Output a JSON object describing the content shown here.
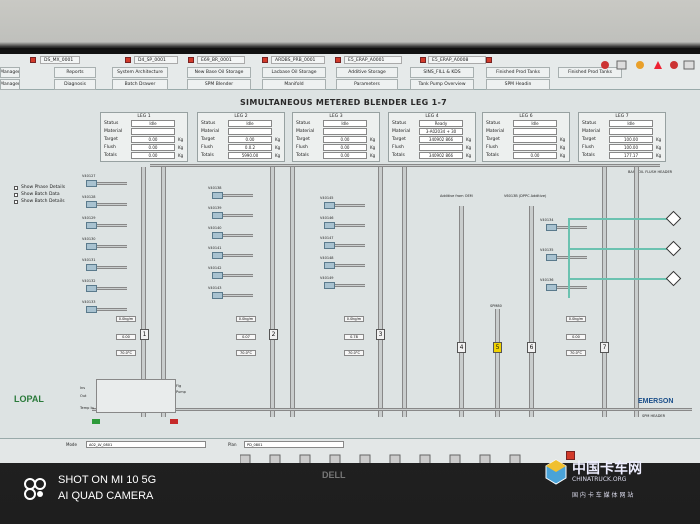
{
  "toolbar": {
    "tabs": [
      "DS_MX_0001",
      "D4_SP_0001",
      "E69_BR_0001",
      "ARDBS_PRB_0001",
      "E5_ERAP_A0001",
      "E5_ERAP_A0008"
    ],
    "buttons_row1": [
      "Manager",
      "Reports",
      "System Architecture",
      "New Base Oil Storage",
      "Lacbase Oil Storage",
      "Additive Storage",
      "SINS_FILL & KDS",
      "Finished Prod Tanks",
      "Finished Prod Tanks"
    ],
    "buttons_row2": [
      "Manager",
      "Diagnosis",
      "Batch Drawer",
      "SPM Blender",
      "Manifold",
      "Parameters",
      "Tank Pump Overview",
      "SPM Headin"
    ]
  },
  "title": "SIMULTANEOUS METERED BLENDER LEG 1-7",
  "legs": [
    {
      "name": "LEG 1",
      "status": "Idle",
      "material": "",
      "target": "0.00",
      "flush": "0.00",
      "totals": "0.00"
    },
    {
      "name": "LEG 2",
      "status": "Idle",
      "material": "",
      "target": "0.00",
      "flush": "0.0.2",
      "totals": "5990.00"
    },
    {
      "name": "LEG 3",
      "status": "Idle",
      "material": "",
      "target": "0.00",
      "flush": "0.00",
      "totals": "0.00"
    },
    {
      "name": "LEG 4",
      "status": "Ready",
      "material": "3-A02034 + 30",
      "target": "340902 866",
      "flush": "",
      "totals": "340902 866"
    },
    {
      "name": "LEG 6",
      "status": "Idle",
      "material": "",
      "target": "",
      "flush": "",
      "totals": "0.00"
    },
    {
      "name": "LEG 7",
      "status": "Idle",
      "material": "",
      "target": "100.00",
      "flush": "100.00",
      "totals": "177.17"
    }
  ],
  "row_labels": {
    "status": "Status",
    "material": "Material",
    "target": "Target",
    "flush": "Flush",
    "totals": "Totals",
    "unit": "Kg"
  },
  "options": [
    "Show Phase Details",
    "Show Batch Data",
    "Show Batch Details"
  ],
  "base_header_label": "BASE OIL FLUSH HEADER",
  "additive_labels": [
    "Additive from OEM",
    "V6013B (DPPC Additive)"
  ],
  "tank_numbers": [
    "1",
    "2",
    "3",
    "4",
    "5",
    "6",
    "7"
  ],
  "dye_label": "SPM80",
  "header_bottom": "SPM HEADER",
  "valve_labels_col1": [
    "V40127",
    "V40128",
    "V40129",
    "V40130",
    "V40131",
    "V40132",
    "V40133"
  ],
  "valve_labels_col2": [
    "V40138",
    "V40139",
    "V40140",
    "V40141",
    "V40142",
    "V40143"
  ],
  "valve_labels_col3": [
    "V40145",
    "V40146",
    "V40147",
    "V40148",
    "V40149"
  ],
  "valve_labels_col7": [
    "V40134",
    "V40135",
    "V40136"
  ],
  "small_values": [
    "0.0kg/m",
    "0.00",
    "70.0°C",
    "0.0kg/m",
    "0.07",
    "70.0°C",
    "0.0kg/m",
    "0.78",
    "70.0°C",
    "0.0kg/m",
    "0.00",
    "70.0°C"
  ],
  "bottom_left": {
    "ins": "Ins",
    "out": "Out",
    "temp_in": "Temp In",
    "flag": "Flg",
    "pump": "Pump"
  },
  "footer": {
    "mode_label": "Mode",
    "mode_value": "A02_LV_0801",
    "plan_label": "Plan",
    "plan_value": "PD_0801"
  },
  "logos": {
    "left": "LOPAL",
    "right": "EMERSON",
    "bezel": "DELL"
  },
  "photo_stamp": {
    "line1": "SHOT ON MI 10 5G",
    "line2": "AI QUAD CAMERA"
  },
  "watermark": {
    "line1": "中国卡车网",
    "line2": "CHINATRUCK.ORG",
    "line3": "国 内 卡 车 媒 体 网 站"
  },
  "colors": {
    "pipe": "#c9cdcd",
    "teal": "#6bc2b0",
    "yellow_tank": "#f0d200",
    "screen_bg": "#dde3e3"
  }
}
